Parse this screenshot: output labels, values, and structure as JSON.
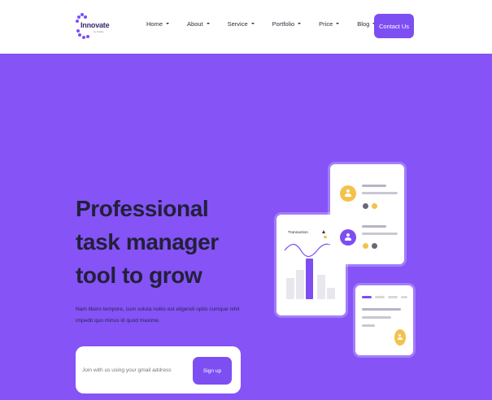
{
  "header": {
    "logo": {
      "name": "Innovate",
      "tagline": "by Studio"
    },
    "nav": [
      {
        "label": "Home"
      },
      {
        "label": "About"
      },
      {
        "label": "Service"
      },
      {
        "label": "Portfolio"
      },
      {
        "label": "Price"
      },
      {
        "label": "Blog"
      }
    ],
    "contact_label": "Contact Us"
  },
  "hero": {
    "title": "Professional task manager tool to grow",
    "description": "Nam libero tempore, cum soluta nobis est eligendi optio cumque nihil impedit quo minus id quod maxime.",
    "signup": {
      "placeholder": "Join with us using your gmail address",
      "button_label": "Sign up"
    }
  },
  "illustration": {
    "transaction_label": "Transaction"
  },
  "colors": {
    "accent": "#7d4ef2",
    "hero_bg": "#8553f6",
    "highlight": "#f4c24c",
    "dark_text": "#22203a"
  }
}
